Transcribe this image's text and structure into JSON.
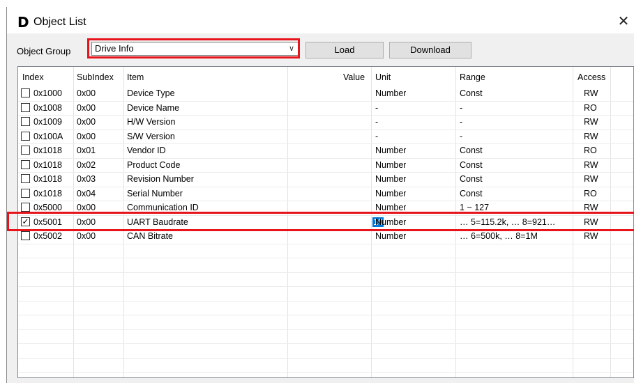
{
  "window": {
    "logo": "D",
    "title": "Object List",
    "close_glyph": "✕"
  },
  "toolbar": {
    "group_label": "Object Group",
    "group_value": "Drive Info",
    "load_label": "Load",
    "download_label": "Download"
  },
  "table": {
    "headers": {
      "index": "Index",
      "subindex": "SubIndex",
      "item": "Item",
      "value": "Value",
      "unit": "Unit",
      "range": "Range",
      "access": "Access"
    },
    "rows": [
      {
        "checked": false,
        "check": "",
        "index": "0x1000",
        "subindex": "0x00",
        "item": "Device Type",
        "value": "",
        "unit": "Number",
        "range": "Const",
        "access": "RW"
      },
      {
        "checked": false,
        "check": "",
        "index": "0x1008",
        "subindex": "0x00",
        "item": "Device Name",
        "value": "",
        "unit": "-",
        "range": "-",
        "access": "RO"
      },
      {
        "checked": false,
        "check": "",
        "index": "0x1009",
        "subindex": "0x00",
        "item": "H/W Version",
        "value": "",
        "unit": "-",
        "range": "-",
        "access": "RW"
      },
      {
        "checked": false,
        "check": "",
        "index": "0x100A",
        "subindex": "0x00",
        "item": "S/W Version",
        "value": "",
        "unit": "-",
        "range": "-",
        "access": "RW"
      },
      {
        "checked": false,
        "check": "",
        "index": "0x1018",
        "subindex": "0x01",
        "item": "Vendor ID",
        "value": "",
        "unit": "Number",
        "range": "Const",
        "access": "RO"
      },
      {
        "checked": false,
        "check": "",
        "index": "0x1018",
        "subindex": "0x02",
        "item": "Product Code",
        "value": "",
        "unit": "Number",
        "range": "Const",
        "access": "RW"
      },
      {
        "checked": false,
        "check": "",
        "index": "0x1018",
        "subindex": "0x03",
        "item": "Revision Number",
        "value": "",
        "unit": "Number",
        "range": "Const",
        "access": "RW"
      },
      {
        "checked": false,
        "check": "",
        "index": "0x1018",
        "subindex": "0x04",
        "item": "Serial Number",
        "value": "",
        "unit": "Number",
        "range": "Const",
        "access": "RO"
      },
      {
        "checked": false,
        "check": "",
        "index": "0x5000",
        "subindex": "0x00",
        "item": "Communication ID",
        "value": "",
        "unit": "Number",
        "range": "1 ~ 127",
        "access": "RW"
      },
      {
        "checked": true,
        "check": "✓",
        "index": "0x5001",
        "subindex": "0x00",
        "item": "UART Baudrate",
        "value": "10",
        "unit": "Number",
        "range": "… 5=115.2k, … 8=921…",
        "access": "RW"
      },
      {
        "checked": false,
        "check": "",
        "index": "0x5002",
        "subindex": "0x00",
        "item": "CAN Bitrate",
        "value": "",
        "unit": "Number",
        "range": "… 6=500k, … 8=1M",
        "access": "RW"
      }
    ]
  },
  "colors": {
    "highlight": "#e8141c",
    "selection": "#0078d7"
  }
}
